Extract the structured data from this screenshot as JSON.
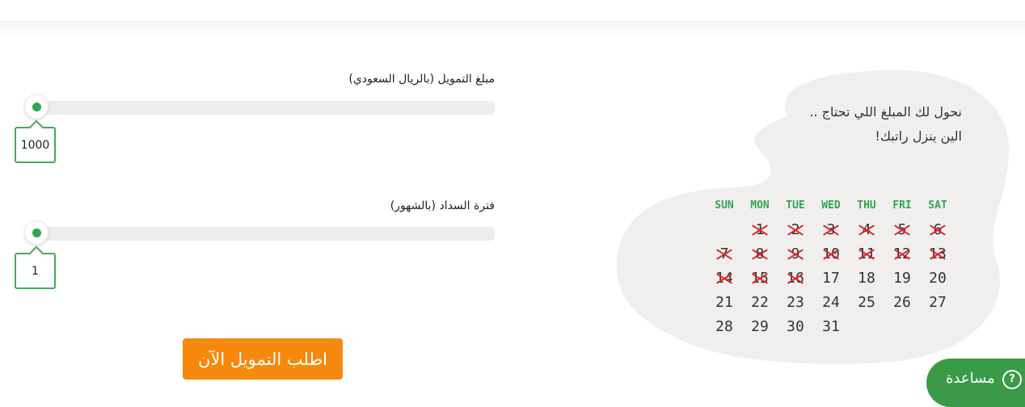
{
  "sliders": {
    "amount": {
      "label": "مبلغ التمويل (بالريال السعودي)",
      "value": "1000",
      "fraction": 0
    },
    "period": {
      "label": "فترة السداد (بالشهور)",
      "value": "1",
      "fraction": 0
    }
  },
  "cta": {
    "label": "اطلب التمويل الآن"
  },
  "promo": {
    "line1": "نحول لك المبلغ اللي تحتاج ..",
    "line2": "الين ينزل راتبك!"
  },
  "calendar": {
    "weekdays": [
      "SUN",
      "MON",
      "TUE",
      "WED",
      "THU",
      "FRI",
      "SAT"
    ],
    "rows": [
      [
        "",
        "1",
        "2",
        "3",
        "4",
        "5",
        "6"
      ],
      [
        "7",
        "8",
        "9",
        "10",
        "11",
        "12",
        "13"
      ],
      [
        "14",
        "15",
        "16",
        "17",
        "18",
        "19",
        "20"
      ],
      [
        "21",
        "22",
        "23",
        "24",
        "25",
        "26",
        "27"
      ],
      [
        "28",
        "29",
        "30",
        "31",
        "",
        "",
        ""
      ]
    ],
    "crossed_through": 16
  },
  "help": {
    "label": "مساعدة",
    "icon": "?"
  },
  "colors": {
    "accent": "#2fa84f",
    "cta": "#f6880e",
    "cross": "#d9252b",
    "help": "#3a9a48"
  }
}
